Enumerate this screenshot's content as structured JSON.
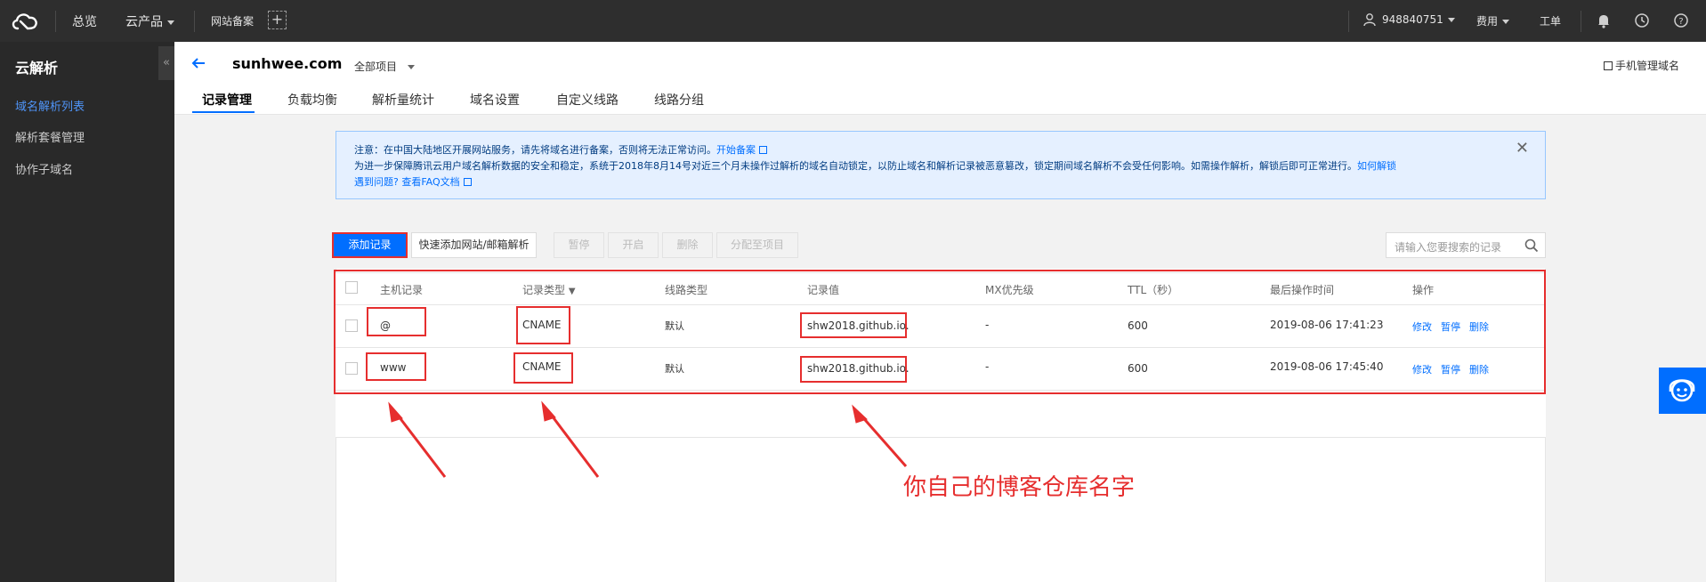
{
  "topbar": {
    "overview": "总览",
    "products": "云产品",
    "beian": "网站备案",
    "plus": "+",
    "account": "948840751",
    "billing": "费用",
    "ticket": "工单",
    "icons": [
      "cloud-logo",
      "user-icon",
      "bell-icon",
      "clock-icon",
      "help-icon"
    ]
  },
  "sidebar": {
    "title": "云解析",
    "collapse": "«",
    "items": [
      {
        "label": "域名解析列表",
        "active": true
      },
      {
        "label": "解析套餐管理",
        "active": false
      },
      {
        "label": "协作子域名",
        "active": false
      }
    ]
  },
  "header": {
    "domain": "sunhwee.com",
    "project": "全部项目",
    "mobile": "手机管理域名",
    "tabs": [
      "记录管理",
      "负载均衡",
      "解析量统计",
      "域名设置",
      "自定义线路",
      "线路分组"
    ]
  },
  "notice": {
    "line1_prefix": "注意：在中国大陆地区开展网站服务，请先将域名进行备案，否则将无法正常访问。",
    "line1_link": "开始备案",
    "line2_prefix": "为进一步保障腾讯云用户域名解析数据的安全和稳定，系统于2018年8月14号对近三个月未操作过解析的域名自动锁定，以防止域名和解析记录被恶意篡改，锁定期间域名解析不会受任何影响。如需操作解析，解锁后即可正常进行。",
    "line2_link": "如何解锁",
    "line3_link_a": "遇到问题?",
    "line3_link_b": "查看FAQ文档",
    "close": "✕"
  },
  "toolbar": {
    "add": "添加记录",
    "quick_add": "快速添加网站/邮箱解析",
    "pause": "暂停",
    "enable": "开启",
    "delete": "删除",
    "assign": "分配至项目",
    "search_placeholder": "请输入您要搜索的记录"
  },
  "table": {
    "headers": [
      "主机记录",
      "记录类型",
      "线路类型",
      "记录值",
      "MX优先级",
      "TTL（秒）",
      "最后操作时间",
      "操作"
    ],
    "rows": [
      {
        "host": "@",
        "type": "CNAME",
        "line": "默认",
        "value": "shw2018.github.io.",
        "mx": "-",
        "ttl": "600",
        "time": "2019-08-06 17:41:23",
        "ops": [
          "修改",
          "暂停",
          "删除"
        ]
      },
      {
        "host": "www",
        "type": "CNAME",
        "line": "默认",
        "value": "shw2018.github.io.",
        "mx": "-",
        "ttl": "600",
        "time": "2019-08-06 17:45:40",
        "ops": [
          "修改",
          "暂停",
          "删除"
        ]
      }
    ]
  },
  "annotation": "你自己的博客仓库名字",
  "colors": {
    "accent": "#006eff",
    "annotation": "#e62e2e",
    "topbar": "#2e2e2e",
    "sidebar": "#292929"
  }
}
